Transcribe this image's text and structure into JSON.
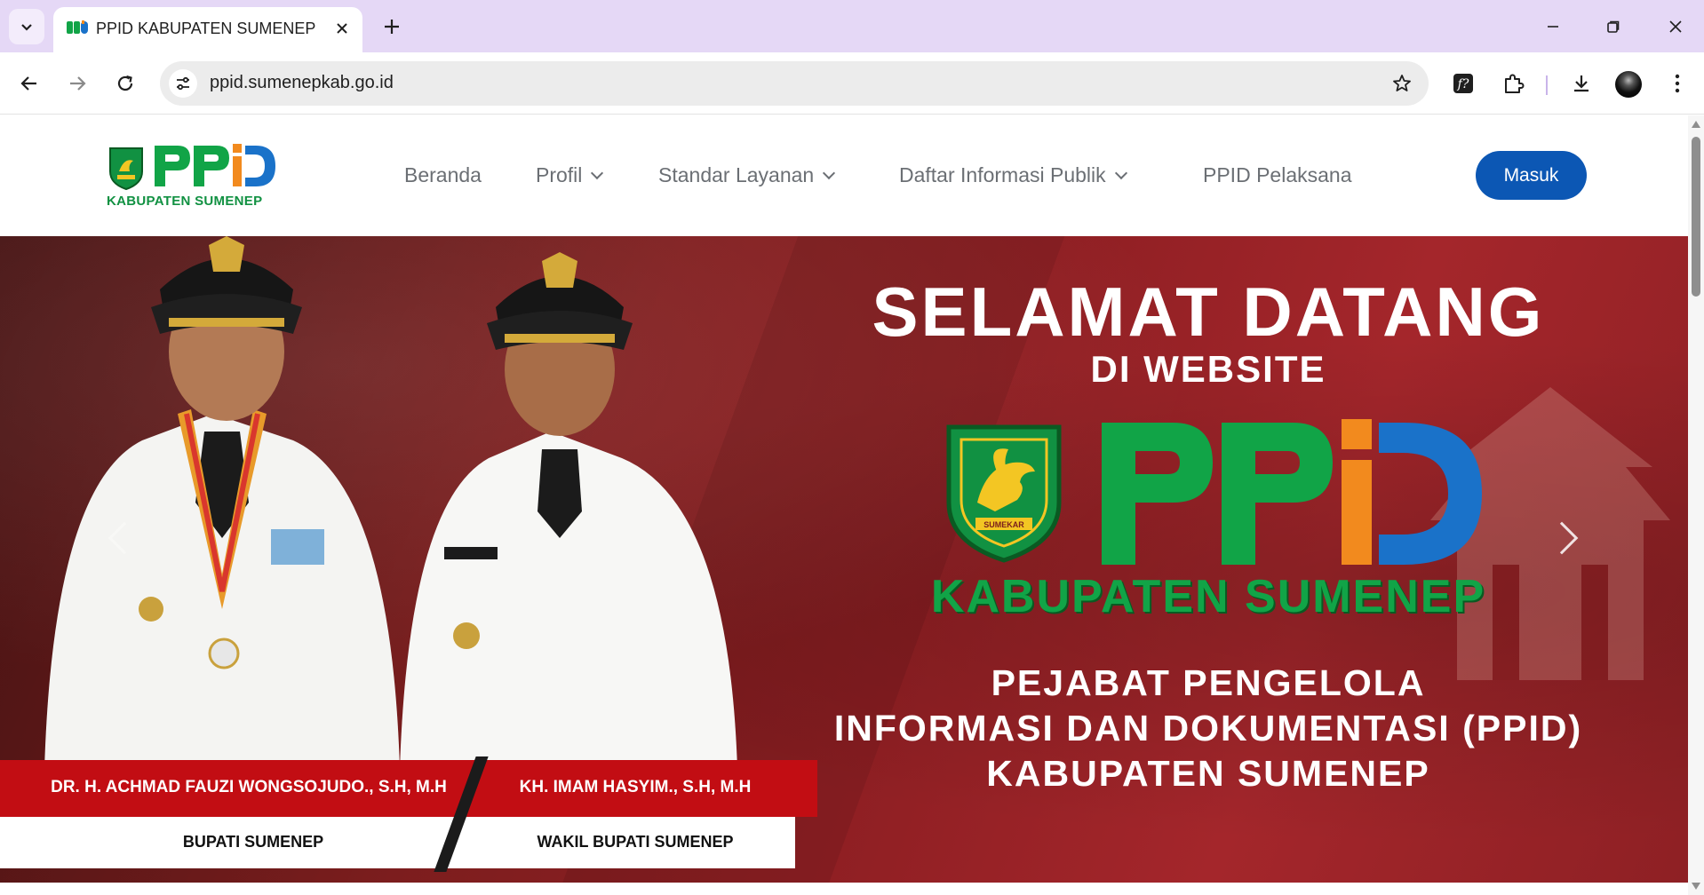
{
  "browser": {
    "tab": {
      "title": "PPID KABUPATEN SUMENEP",
      "favicon": "ppid-favicon"
    },
    "url": "ppid.sumenepkab.go.id",
    "toolbar_icons": [
      "back-icon",
      "forward-icon",
      "reload-icon",
      "site-info-icon",
      "bookmark-star-icon",
      "formula-extension-icon",
      "extensions-icon",
      "download-icon",
      "profile-avatar",
      "menu-icon"
    ]
  },
  "site": {
    "logo_caption": "KABUPATEN SUMENEP",
    "logo_text": "PPID",
    "nav": [
      {
        "label": "Beranda",
        "dropdown": false
      },
      {
        "label": "Profil",
        "dropdown": true
      },
      {
        "label": "Standar Layanan",
        "dropdown": true
      },
      {
        "label": "Daftar Informasi Publik",
        "dropdown": true
      },
      {
        "label": "PPID Pelaksana",
        "dropdown": false
      }
    ],
    "login_label": "Masuk"
  },
  "hero": {
    "title": "SELAMAT DATANG",
    "subtitle": "DI WEBSITE",
    "brand": "PPID",
    "emblem_ribbon": "SUMEKAR",
    "region": "KABUPATEN SUMENEP",
    "lines": [
      "PEJABAT PENGELOLA",
      "INFORMASI DAN DOKUMENTASI (PPID)",
      "KABUPATEN SUMENEP"
    ],
    "people": [
      {
        "name": "DR. H. ACHMAD FAUZI WONGSOJUDO., S.H, M.H",
        "role": "BUPATI SUMENEP"
      },
      {
        "name": "KH. IMAM HASYIM., S.H, M.H",
        "role": "WAKIL BUPATI SUMENEP"
      }
    ],
    "colors": {
      "red_band": "#c20d13",
      "green": "#11a447",
      "blue": "#1a72c9",
      "orange": "#f28a1e",
      "login": "#0c57b4"
    }
  }
}
